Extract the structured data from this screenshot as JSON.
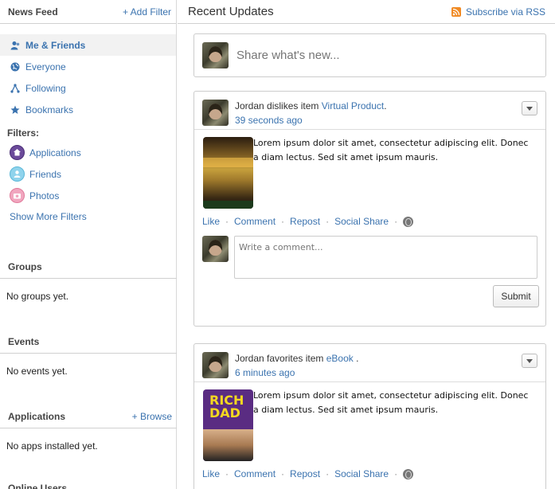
{
  "sidebar": {
    "title": "News Feed",
    "add_filter": "+ Add Filter",
    "nav": [
      {
        "label": "Me & Friends",
        "icon": "person-icon"
      },
      {
        "label": "Everyone",
        "icon": "globe-icon"
      },
      {
        "label": "Following",
        "icon": "network-icon"
      },
      {
        "label": "Bookmarks",
        "icon": "star-icon"
      }
    ],
    "filters_label": "Filters:",
    "filters": [
      {
        "label": "Applications",
        "icon": "applications-icon",
        "color": "#6b4a9a"
      },
      {
        "label": "Friends",
        "icon": "friends-icon",
        "color": "#5ab7d8"
      },
      {
        "label": "Photos",
        "icon": "photos-icon",
        "color": "#e07a9a"
      }
    ],
    "show_more": "Show More Filters",
    "groups": {
      "title": "Groups",
      "empty": "No groups yet."
    },
    "events": {
      "title": "Events",
      "empty": "No events yet."
    },
    "applications": {
      "title": "Applications",
      "browse": "+ Browse",
      "empty": "No apps installed yet."
    },
    "online_users": {
      "title": "Online Users"
    }
  },
  "main": {
    "title": "Recent Updates",
    "rss": "Subscribe via RSS",
    "share_placeholder": "Share what's new...",
    "posts": [
      {
        "actor": "Jordan",
        "verb": "dislikes item",
        "item": "Virtual Product",
        "suffix": ".",
        "time": "39 seconds ago",
        "text": "Lorem ipsum dolor sit amet, consectetur adipiscing elit. Donec a diam lectus. Sed sit amet ipsum mauris.",
        "actions": [
          "Like",
          "Comment",
          "Repost",
          "Social Share"
        ],
        "comment_placeholder": "Write a comment...",
        "submit": "Submit"
      },
      {
        "actor": "Jordan",
        "verb": "favorites item",
        "item": "eBook",
        "suffix": " .",
        "time": "6 minutes ago",
        "text": "Lorem ipsum dolor sit amet, consectetur adipiscing elit. Donec a diam lectus. Sed sit amet ipsum mauris.",
        "actions": [
          "Like",
          "Comment",
          "Repost",
          "Social Share"
        ]
      }
    ]
  },
  "thumbnails": {
    "ebook_title": "RICH DAD"
  }
}
